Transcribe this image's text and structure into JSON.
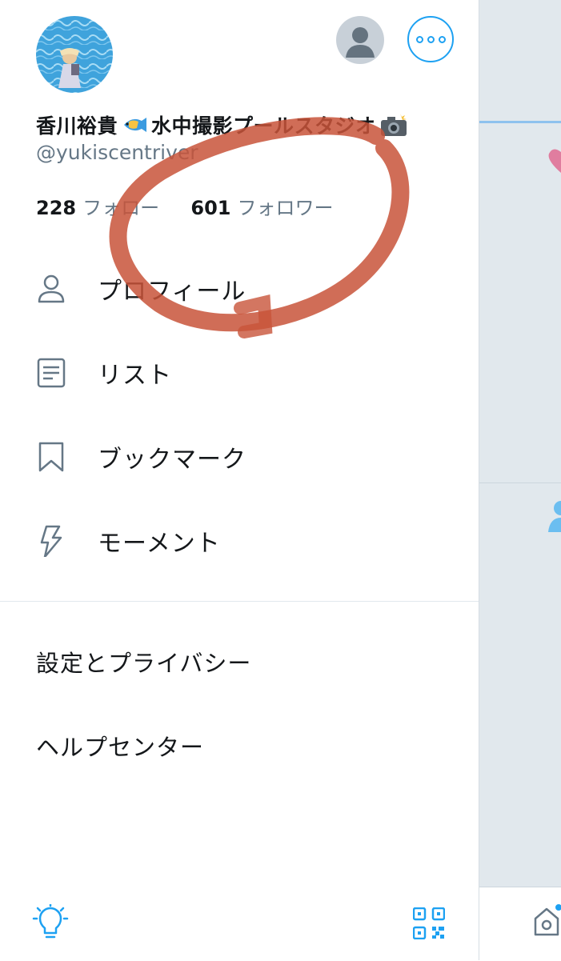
{
  "profile": {
    "display_name": "香川裕貴",
    "display_name_suffix": "水中撮影プールスタジオ",
    "handle": "@yukiscentriver",
    "following_count": "228",
    "following_label": "フォロー",
    "followers_count": "601",
    "followers_label": "フォロワー"
  },
  "menu": {
    "items": [
      {
        "label": "プロフィール",
        "icon": "person-icon"
      },
      {
        "label": "リスト",
        "icon": "list-icon"
      },
      {
        "label": "ブックマーク",
        "icon": "bookmark-icon"
      },
      {
        "label": "モーメント",
        "icon": "lightning-icon"
      }
    ],
    "secondary": [
      {
        "label": "設定とプライバシー"
      },
      {
        "label": "ヘルプセンター"
      }
    ]
  },
  "footer": {
    "left_icon": "lightbulb-icon",
    "right_icon": "qr-code-icon"
  },
  "colors": {
    "accent": "#1da1f2",
    "annotation": "#c8543a",
    "muted_text": "#657786"
  }
}
